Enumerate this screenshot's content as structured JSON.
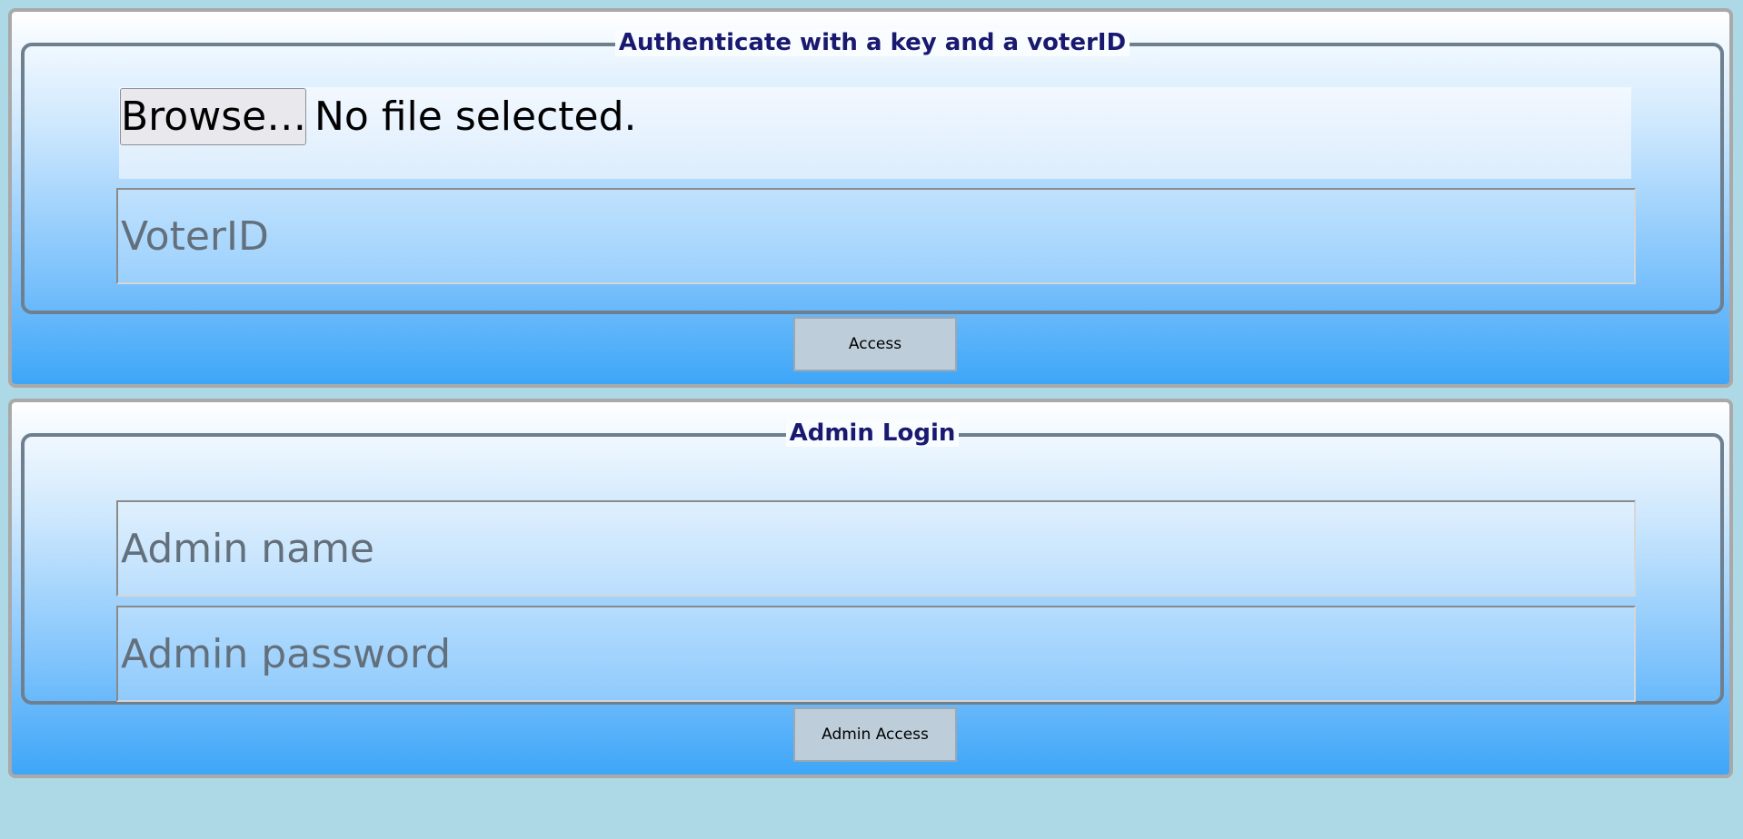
{
  "key_auth": {
    "legend": "Authenticate with a key and a voterID",
    "file": {
      "button_label": "Browse…",
      "status": "No file selected."
    },
    "voter_id": {
      "value": "",
      "placeholder": "VoterID"
    },
    "submit_label": "Access"
  },
  "admin_login": {
    "legend": "Admin Login",
    "admin_name": {
      "value": "",
      "placeholder": "Admin name"
    },
    "admin_password": {
      "value": "",
      "placeholder": "Admin password"
    },
    "submit_label": "Admin Access"
  },
  "colors": {
    "page_background": "#add8e6",
    "legend_text": "#191970",
    "fieldset_border": "#6e7f8f",
    "button_background": "#bdcdd9"
  }
}
